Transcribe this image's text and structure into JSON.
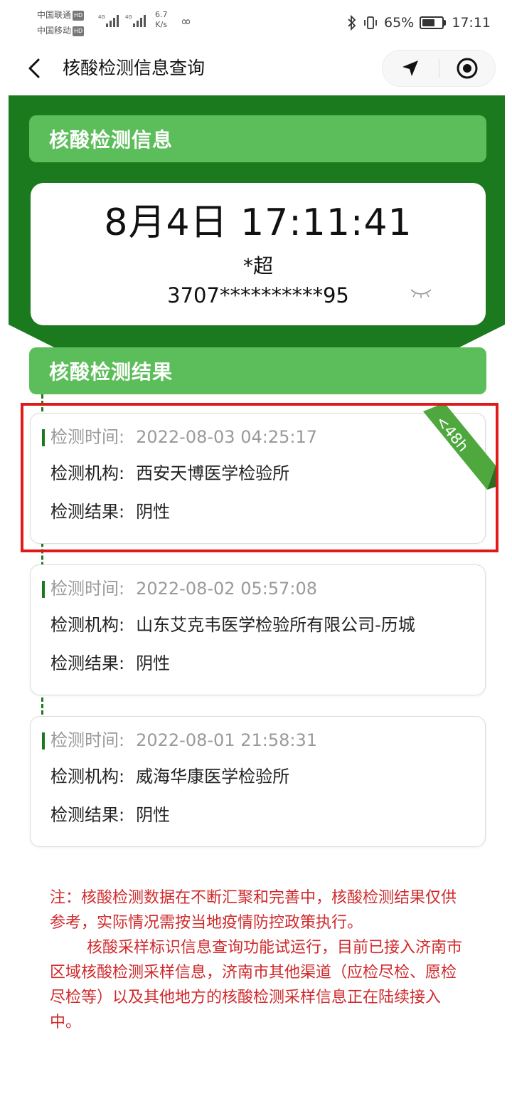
{
  "status_bar": {
    "carrier_1": "中国联通",
    "carrier_2": "中国移动",
    "hd": "HD",
    "net_speed_value": "6.7",
    "net_speed_unit": "K/s",
    "battery_percent": "65%",
    "battery_level": 0.65,
    "time": "17:11",
    "icons": [
      "signal-icon",
      "infinity-icon",
      "bluetooth-icon",
      "vibrate-icon",
      "battery-icon"
    ]
  },
  "nav": {
    "title": "核酸检测信息查询",
    "icons": [
      "back-arrow-icon",
      "location-arrow-icon",
      "record-target-icon"
    ]
  },
  "info_section": {
    "header": "核酸检测信息",
    "datetime": "8月4日 17:11:41",
    "name": "*超",
    "id_number": "3707**********95",
    "eye_icon": "eye-closed-icon"
  },
  "results_section": {
    "header": "核酸检测结果",
    "ribbon": "<48h",
    "time_label": "检测时间:",
    "org_label": "检测机构:",
    "result_label": "检测结果:",
    "records": [
      {
        "time": "2022-08-03 04:25:17",
        "org": "西安天博医学检验所",
        "result": "阴性"
      },
      {
        "time": "2022-08-02 05:57:08",
        "org": "山东艾克韦医学检验所有限公司-历城",
        "result": "阴性"
      },
      {
        "time": "2022-08-01 21:58:31",
        "org": "威海华康医学检验所",
        "result": "阴性"
      }
    ]
  },
  "notice": {
    "paragraph_1": "注：核酸检测数据在不断汇聚和完善中，核酸检测结果仅供参考，实际情况需按当地疫情防控政策执行。",
    "paragraph_2": "核酸采样标识信息查询功能试运行，目前已接入济南市区域核酸检测采样信息，济南市其他渠道（应检尽检、愿检尽检等）以及其他地方的核酸检测采样信息正在陆续接入中。"
  },
  "colors": {
    "dark_green": "#1c7a1e",
    "light_green": "#5cbe5a",
    "notice_red": "#d0292b",
    "highlight_red": "#e01a1a",
    "ribbon_green": "#4ea83e"
  }
}
